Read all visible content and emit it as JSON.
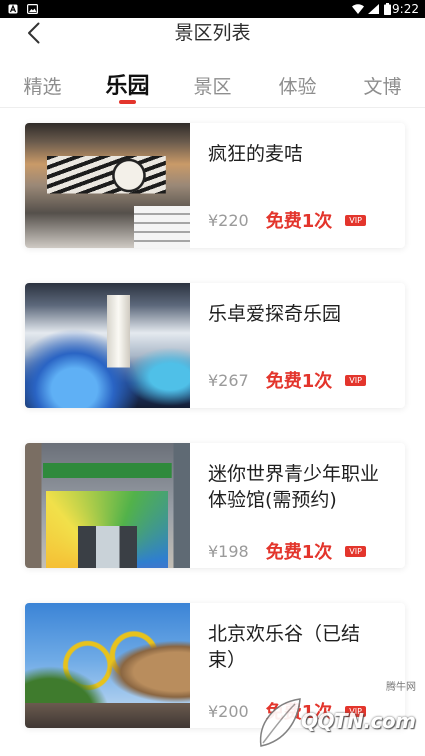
{
  "status_bar": {
    "time": "9:22",
    "left_icons": [
      "app-notification-icon",
      "image-notification-icon"
    ],
    "right_icons": [
      "wifi-icon",
      "cell-signal-icon",
      "battery-icon"
    ]
  },
  "header": {
    "back_icon": "chevron-left-icon",
    "title": "景区列表"
  },
  "tabs": [
    {
      "label": "精选",
      "selected": false
    },
    {
      "label": "乐园",
      "selected": true
    },
    {
      "label": "景区",
      "selected": false
    },
    {
      "label": "体验",
      "selected": false
    },
    {
      "label": "文博",
      "selected": false
    }
  ],
  "items": [
    {
      "name": "疯狂的麦咭",
      "price": "¥220",
      "offer": "免费1次",
      "badge": "VIP"
    },
    {
      "name": "乐卓爱探奇乐园",
      "price": "¥267",
      "offer": "免费1次",
      "badge": "VIP"
    },
    {
      "name": "迷你世界青少年职业体验馆(需预约)",
      "price": "¥198",
      "offer": "免费1次",
      "badge": "VIP"
    },
    {
      "name": "北京欢乐谷（已结束）",
      "price": "¥200",
      "offer": "免费1次",
      "badge": "VIP"
    }
  ],
  "colors": {
    "accent": "#e3352c",
    "title_text": "#1f1f1f",
    "muted_text": "#9a9a9a",
    "status_bar": "#000000"
  },
  "watermark": {
    "site_name": "腾牛网",
    "logo_text": "QQTN.com"
  }
}
